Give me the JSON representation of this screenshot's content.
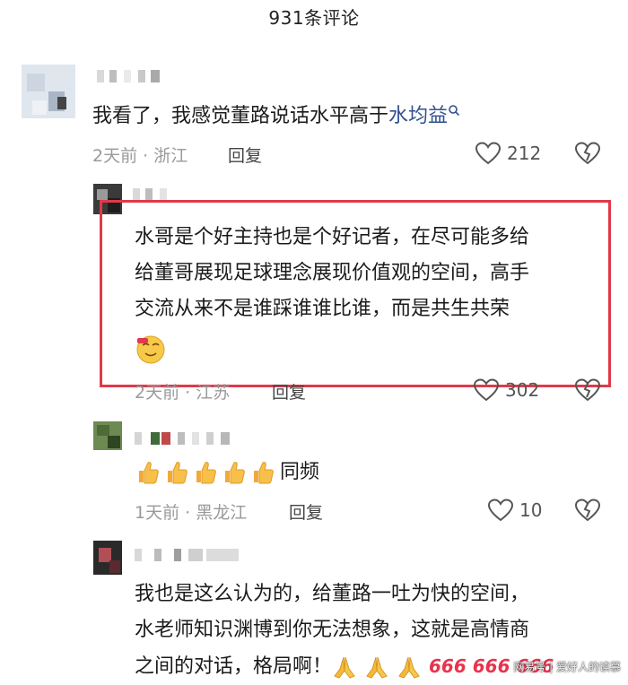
{
  "header": {
    "title": "931条评论"
  },
  "comments": [
    {
      "text_parts": [
        "我看了，我感觉董路说话水平高于",
        "水均益"
      ],
      "meta": "2天前 · 浙江",
      "reply_label": "回复",
      "likes": "212"
    },
    {
      "lines": [
        "水哥是个好主持也是个好记者，在尽可能多给",
        "给董哥展现足球理念展现价值观的空间，高手",
        "交流从来不是谁踩谁谁比谁，而是共生共荣"
      ],
      "meta": "2天前 · 江苏",
      "reply_label": "回复",
      "likes": "302"
    },
    {
      "text_suffix": "同频",
      "meta": "1天前 · 黑龙江",
      "reply_label": "回复",
      "likes": "10"
    },
    {
      "lines": [
        "我也是这么认为的，给董路一吐为快的空间，",
        "水老师知识渊博到你无法想象，这就是高情商",
        "之间的对话，格局啊！"
      ],
      "six_tokens": [
        "666",
        "666",
        "666"
      ]
    }
  ],
  "watermark": "网易号 | 爱好人的读慕",
  "colors": {
    "highlight": "#e0394a",
    "link": "#2f4f8f",
    "meta": "#9a9a9a"
  },
  "icons": [
    "search-icon",
    "heart-icon",
    "broken-heart-icon",
    "thumbs-up-icon",
    "pray-icon",
    "smile-emoji-icon"
  ]
}
